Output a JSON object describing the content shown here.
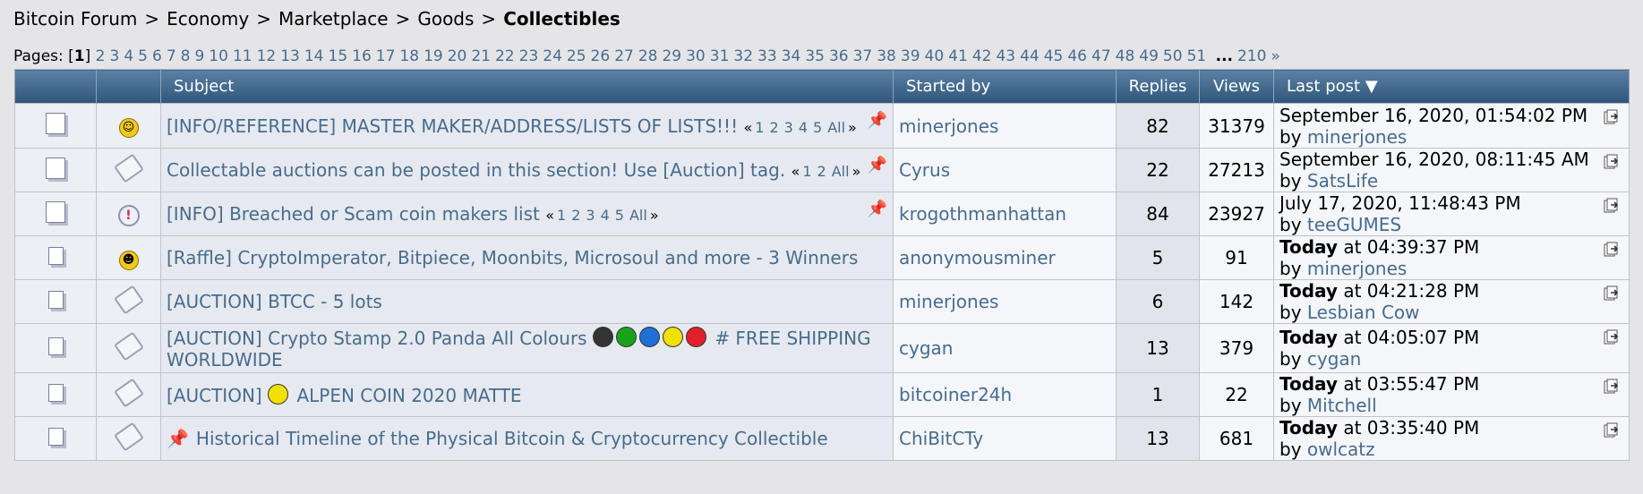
{
  "breadcrumb": {
    "items": [
      "Bitcoin Forum",
      "Economy",
      "Marketplace",
      "Goods"
    ],
    "current": "Collectibles",
    "separator": ">"
  },
  "pages": {
    "label": "Pages: [",
    "current": "1",
    "close": "]",
    "numbers": [
      "2",
      "3",
      "4",
      "5",
      "6",
      "7",
      "8",
      "9",
      "10",
      "11",
      "12",
      "13",
      "14",
      "15",
      "16",
      "17",
      "18",
      "19",
      "20",
      "21",
      "22",
      "23",
      "24",
      "25",
      "26",
      "27",
      "28",
      "29",
      "30",
      "31",
      "32",
      "33",
      "34",
      "35",
      "36",
      "37",
      "38",
      "39",
      "40",
      "41",
      "42",
      "43",
      "44",
      "45",
      "46",
      "47",
      "48",
      "49",
      "50",
      "51"
    ],
    "ellipsis": "...",
    "last": "210",
    "next": "»"
  },
  "table": {
    "headers": {
      "subject": "Subject",
      "started_by": "Started by",
      "replies": "Replies",
      "views": "Views",
      "last_post": "Last post"
    },
    "rows": [
      {
        "subject": "[INFO/REFERENCE] MASTER MAKER/ADDRESS/LISTS OF LISTS!!!",
        "pages": [
          "1",
          "2",
          "3",
          "4",
          "5",
          "All"
        ],
        "pinned": true,
        "starter": "minerjones",
        "replies": "82",
        "views": "31379",
        "lp_date": "September 16, 2020, 01:54:02 PM",
        "lp_today": "",
        "lp_by": "by",
        "lp_user": "minerjones",
        "icon": "smiley-icon"
      },
      {
        "subject": "Collectable auctions can be posted in this section! Use [Auction] tag.",
        "pages": [
          "1",
          "2",
          "All"
        ],
        "pinned": true,
        "starter": "Cyrus",
        "replies": "22",
        "views": "27213",
        "lp_date": "September 16, 2020, 08:11:45 AM",
        "lp_today": "",
        "lp_by": "by",
        "lp_user": "SatsLife",
        "icon": "tag-icon"
      },
      {
        "subject": "[INFO] Breached or Scam coin makers list",
        "pages": [
          "1",
          "2",
          "3",
          "4",
          "5",
          "All"
        ],
        "pinned": true,
        "starter": "krogothmanhattan",
        "replies": "84",
        "views": "23927",
        "lp_date": "July 17, 2020, 11:48:43 PM",
        "lp_today": "",
        "lp_by": "by",
        "lp_user": "teeGUMES",
        "icon": "exclamation-icon"
      },
      {
        "subject": "[Raffle] CryptoImperator, Bitpiece, Moonbits, Microsoul and more - 3 Winners",
        "pages": [],
        "pinned": false,
        "starter": "anonymousminer",
        "replies": "5",
        "views": "91",
        "lp_date": " at 04:39:37 PM",
        "lp_today": "Today",
        "lp_by": "by",
        "lp_user": "minerjones",
        "icon": "grin-icon"
      },
      {
        "subject": "[AUCTION] BTCC - 5 lots",
        "pages": [],
        "pinned": false,
        "starter": "minerjones",
        "replies": "6",
        "views": "142",
        "lp_date": " at 04:21:28 PM",
        "lp_today": "Today",
        "lp_by": "by",
        "lp_user": "Lesbian Cow",
        "icon": "tag-icon"
      },
      {
        "subject": "[AUCTION] Crypto Stamp 2.0 Panda All Colours",
        "subject_tail": "# FREE SHIPPING WORLDWIDE",
        "dots": [
          "#333333",
          "#1aa31a",
          "#1f6fd6",
          "#f2e000",
          "#e0202a"
        ],
        "pages": [],
        "pinned": false,
        "starter": "cygan",
        "replies": "13",
        "views": "379",
        "lp_date": " at 04:05:07 PM",
        "lp_today": "Today",
        "lp_by": "by",
        "lp_user": "cygan",
        "icon": "tag-icon"
      },
      {
        "subject": "[AUCTION]",
        "subject_tail": "ALPEN COIN 2020 MATTE",
        "dots": [
          "#f2e000"
        ],
        "pages": [],
        "pinned": false,
        "starter": "bitcoiner24h",
        "replies": "1",
        "views": "22",
        "lp_date": " at 03:55:47 PM",
        "lp_today": "Today",
        "lp_by": "by",
        "lp_user": "Mitchell",
        "icon": "tag-icon"
      },
      {
        "subject": "Historical Timeline of the Physical Bitcoin & Cryptocurrency Collectible",
        "pages": [],
        "pinned": false,
        "pushpin": true,
        "starter": "ChiBitCTy",
        "replies": "13",
        "views": "681",
        "lp_date": " at 03:35:40 PM",
        "lp_today": "Today",
        "lp_by": "by",
        "lp_user": "owlcatz",
        "icon": "tag-icon"
      }
    ]
  }
}
